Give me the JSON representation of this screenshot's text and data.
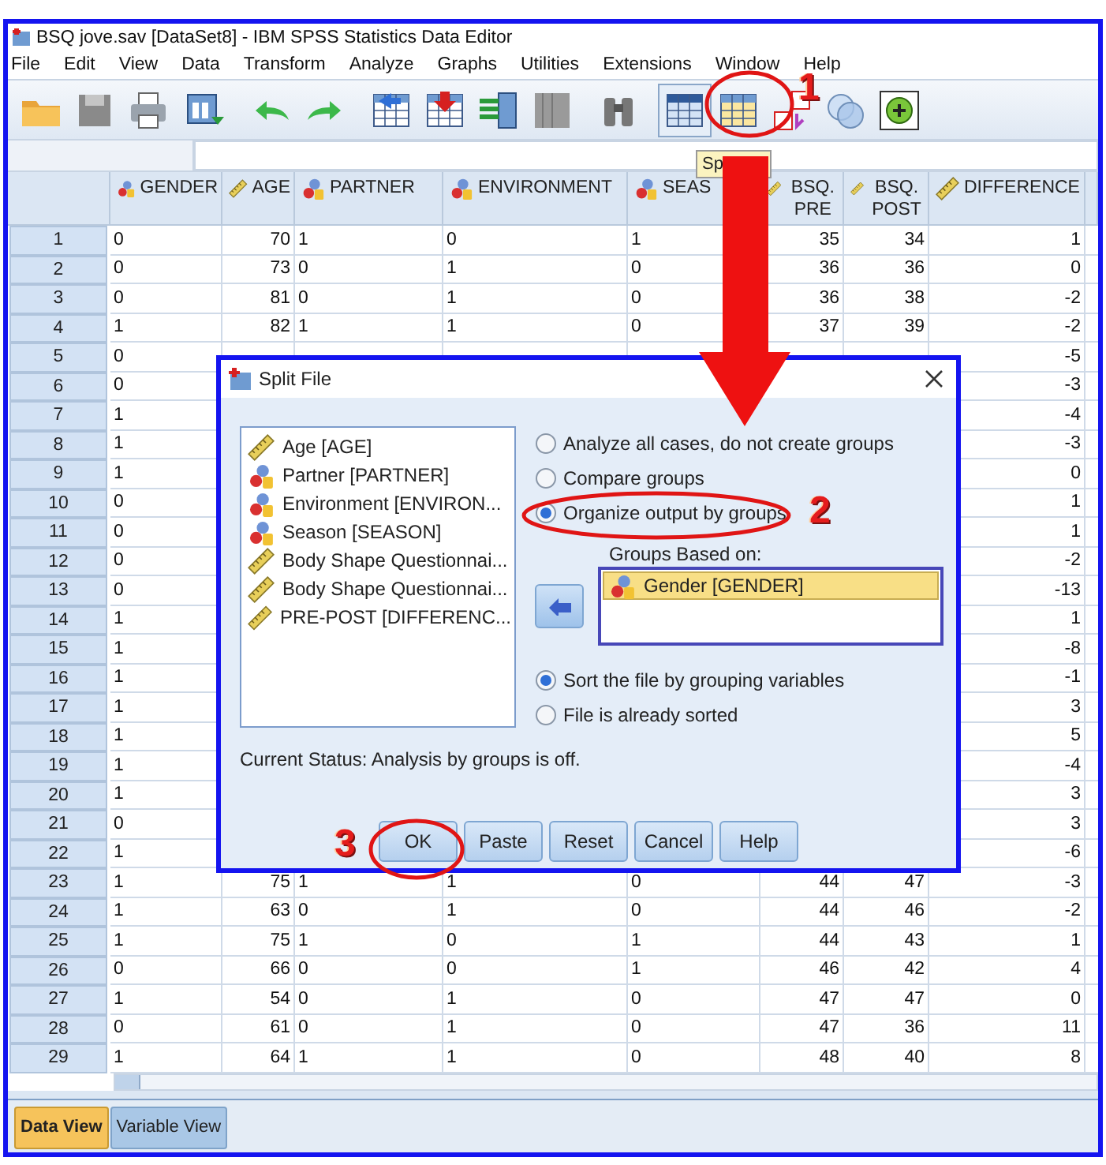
{
  "window": {
    "title": "BSQ jove.sav [DataSet8] - IBM SPSS Statistics Data Editor"
  },
  "menu": [
    "File",
    "Edit",
    "View",
    "Data",
    "Transform",
    "Analyze",
    "Graphs",
    "Utilities",
    "Extensions",
    "Window",
    "Help"
  ],
  "tooltip": "Sp",
  "table": {
    "columns": [
      {
        "label": "GENDER",
        "kind": "nominal"
      },
      {
        "label": "AGE",
        "kind": "scale"
      },
      {
        "label": "PARTNER",
        "kind": "nominal"
      },
      {
        "label": "ENVIRONMENT",
        "kind": "nominal"
      },
      {
        "label": "SEAS",
        "kind": "nominal"
      },
      {
        "label": "BSQ. PRE",
        "kind": "scale"
      },
      {
        "label": "BSQ. POST",
        "kind": "scale"
      },
      {
        "label": "DIFFERENCE",
        "kind": "scale"
      }
    ],
    "rows": [
      {
        "row": "1",
        "kind": "full",
        "cells": [
          "0",
          "70",
          "1",
          "0",
          "1",
          "35",
          "34",
          "1"
        ]
      },
      {
        "row": "2",
        "kind": "full",
        "cells": [
          "0",
          "73",
          "0",
          "1",
          "0",
          "36",
          "36",
          "0"
        ]
      },
      {
        "row": "3",
        "kind": "full",
        "cells": [
          "0",
          "81",
          "0",
          "1",
          "0",
          "36",
          "38",
          "-2"
        ]
      },
      {
        "row": "4",
        "kind": "full",
        "cells": [
          "1",
          "82",
          "1",
          "1",
          "0",
          "37",
          "39",
          "-2"
        ]
      },
      {
        "row": "5",
        "kind": "covered",
        "cells": [
          "0",
          "-5"
        ]
      },
      {
        "row": "6",
        "kind": "covered",
        "cells": [
          "0",
          "-3"
        ]
      },
      {
        "row": "7",
        "kind": "covered",
        "cells": [
          "1",
          "-4"
        ]
      },
      {
        "row": "8",
        "kind": "covered",
        "cells": [
          "1",
          "-3"
        ]
      },
      {
        "row": "9",
        "kind": "covered",
        "cells": [
          "1",
          "0"
        ]
      },
      {
        "row": "10",
        "kind": "covered",
        "cells": [
          "0",
          "1"
        ]
      },
      {
        "row": "11",
        "kind": "covered",
        "cells": [
          "0",
          "1"
        ]
      },
      {
        "row": "12",
        "kind": "covered",
        "cells": [
          "0",
          "-2"
        ]
      },
      {
        "row": "13",
        "kind": "covered",
        "cells": [
          "0",
          "-13"
        ]
      },
      {
        "row": "14",
        "kind": "covered",
        "cells": [
          "1",
          "1"
        ]
      },
      {
        "row": "15",
        "kind": "covered",
        "cells": [
          "1",
          "-8"
        ]
      },
      {
        "row": "16",
        "kind": "covered",
        "cells": [
          "1",
          "-1"
        ]
      },
      {
        "row": "17",
        "kind": "covered",
        "cells": [
          "1",
          "3"
        ]
      },
      {
        "row": "18",
        "kind": "covered",
        "cells": [
          "1",
          "5"
        ]
      },
      {
        "row": "19",
        "kind": "covered",
        "cells": [
          "1",
          "-4"
        ]
      },
      {
        "row": "20",
        "kind": "covered",
        "cells": [
          "1",
          "3"
        ]
      },
      {
        "row": "21",
        "kind": "covered",
        "cells": [
          "0",
          "3"
        ]
      },
      {
        "row": "22",
        "kind": "covered",
        "cells": [
          "1",
          "-6"
        ]
      },
      {
        "row": "23",
        "kind": "full",
        "cells": [
          "1",
          "75",
          "1",
          "1",
          "0",
          "44",
          "47",
          "-3"
        ]
      },
      {
        "row": "24",
        "kind": "full",
        "cells": [
          "1",
          "63",
          "0",
          "1",
          "0",
          "44",
          "46",
          "-2"
        ]
      },
      {
        "row": "25",
        "kind": "full",
        "cells": [
          "1",
          "75",
          "1",
          "0",
          "1",
          "44",
          "43",
          "1"
        ]
      },
      {
        "row": "26",
        "kind": "full",
        "cells": [
          "0",
          "66",
          "0",
          "0",
          "1",
          "46",
          "42",
          "4"
        ]
      },
      {
        "row": "27",
        "kind": "full",
        "cells": [
          "1",
          "54",
          "0",
          "1",
          "0",
          "47",
          "47",
          "0"
        ]
      },
      {
        "row": "28",
        "kind": "full",
        "cells": [
          "0",
          "61",
          "0",
          "1",
          "0",
          "47",
          "36",
          "11"
        ]
      },
      {
        "row": "29",
        "kind": "full",
        "cells": [
          "1",
          "64",
          "1",
          "1",
          "0",
          "48",
          "40",
          "8"
        ]
      }
    ]
  },
  "dialog": {
    "title": "Split File",
    "variables": [
      {
        "label": "Age [AGE]",
        "kind": "scale"
      },
      {
        "label": "Partner [PARTNER]",
        "kind": "nominal"
      },
      {
        "label": "Environment [ENVIRON...",
        "kind": "nominal"
      },
      {
        "label": "Season [SEASON]",
        "kind": "nominal"
      },
      {
        "label": "Body Shape Questionnai...",
        "kind": "scale"
      },
      {
        "label": "Body Shape Questionnai...",
        "kind": "scale"
      },
      {
        "label": "PRE-POST [DIFFERENC...",
        "kind": "scale"
      }
    ],
    "mode_options": [
      {
        "label": "Analyze all cases, do not create groups",
        "selected": false
      },
      {
        "label": "Compare groups",
        "selected": false
      },
      {
        "label": "Organize output by groups",
        "selected": true
      }
    ],
    "groups_label": "Groups Based on:",
    "groups": [
      {
        "label": "Gender [GENDER]",
        "kind": "nominal",
        "selected": true
      }
    ],
    "sort_options": [
      {
        "label": "Sort the file by grouping variables",
        "selected": true
      },
      {
        "label": "File is already sorted",
        "selected": false
      }
    ],
    "status": "Current Status: Analysis by groups is off.",
    "buttons": [
      "OK",
      "Paste",
      "Reset",
      "Cancel",
      "Help"
    ]
  },
  "step_labels": [
    "1",
    "2",
    "3"
  ],
  "view_tabs": [
    {
      "label": "Data View",
      "selected": true
    },
    {
      "label": "Variable View",
      "selected": false
    }
  ]
}
